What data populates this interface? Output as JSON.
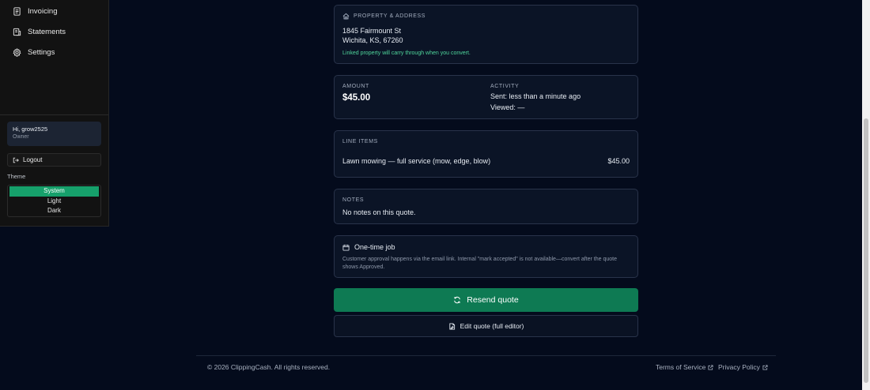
{
  "sidebar": {
    "items": [
      {
        "label": "Invoicing",
        "icon": "invoice-icon"
      },
      {
        "label": "Statements",
        "icon": "statements-icon"
      },
      {
        "label": "Settings",
        "icon": "gear-icon"
      }
    ],
    "user": {
      "greeting": "Hi, grow2525",
      "role": "Owner"
    },
    "logout_label": "Logout",
    "theme_label": "Theme",
    "theme_options": [
      "System",
      "Light",
      "Dark"
    ],
    "theme_selected": "System"
  },
  "property": {
    "label": "PROPERTY & ADDRESS",
    "line1": "1845 Fairmount St",
    "line2": "Wichita, KS, 67260",
    "note": "Linked property will carry through when you convert."
  },
  "summary": {
    "amount_label": "AMOUNT",
    "amount_value": "$45.00",
    "activity_label": "ACTIVITY",
    "sent": "Sent: less than a minute ago",
    "viewed": "Viewed: —"
  },
  "line_items": {
    "label": "LINE ITEMS",
    "items": [
      {
        "description": "Lawn mowing — full service (mow, edge, blow)",
        "price": "$45.00"
      }
    ]
  },
  "notes": {
    "label": "NOTES",
    "text": "No notes on this quote."
  },
  "job": {
    "title": "One-time job",
    "description": "Customer approval happens via the email link. Internal \"mark accepted\" is not available—convert after the quote shows Approved."
  },
  "actions": {
    "resend_label": "Resend quote",
    "edit_label": "Edit quote (full editor)"
  },
  "footer": {
    "copyright": "© 2026 ClippingCash. All rights reserved.",
    "terms": "Terms of Service",
    "privacy": "Privacy Policy"
  },
  "colors": {
    "background": "#040b1c",
    "accent": "#0e7a53",
    "theme_active": "#16a06b",
    "note_green": "#4fd59b"
  }
}
